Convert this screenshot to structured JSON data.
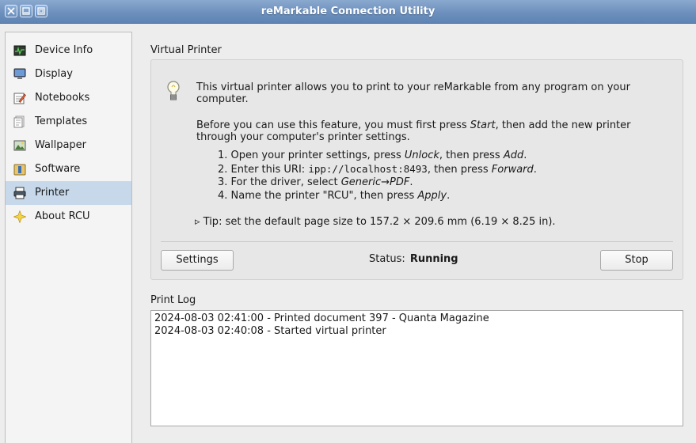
{
  "window": {
    "title": "reMarkable Connection Utility",
    "controls": [
      "close-icon",
      "minimize-icon",
      "maximize-icon"
    ]
  },
  "sidebar": {
    "items": [
      {
        "label": "Device Info",
        "icon": "device-info-icon"
      },
      {
        "label": "Display",
        "icon": "display-icon"
      },
      {
        "label": "Notebooks",
        "icon": "notebooks-icon"
      },
      {
        "label": "Templates",
        "icon": "templates-icon"
      },
      {
        "label": "Wallpaper",
        "icon": "wallpaper-icon"
      },
      {
        "label": "Software",
        "icon": "software-icon"
      },
      {
        "label": "Printer",
        "icon": "printer-icon",
        "selected": true
      },
      {
        "label": "About RCU",
        "icon": "about-icon"
      }
    ],
    "selected_color": "#c6d8ea"
  },
  "virtual_printer": {
    "title": "Virtual Printer",
    "intro_line1": "This virtual printer allows you to print to your reMarkable from any program on your",
    "intro_line2": "computer.",
    "before_pre": "Before you can use this feature, you must first press ",
    "before_em": "Start",
    "before_post": ", then add the new printer",
    "before_line2": "through your computer's printer settings.",
    "step1_pre": "1. Open your printer settings, press ",
    "step1_em1": "Unlock",
    "step1_mid": ", then press ",
    "step1_em2": "Add",
    "step1_post": ".",
    "step2_pre": "2. Enter this URI: ",
    "step2_uri": "ipp://localhost:8493",
    "step2_mid": ", then press ",
    "step2_em": "Forward",
    "step2_post": ".",
    "step3_pre": "3. For the driver, select ",
    "step3_em": "Generic→PDF",
    "step3_post": ".",
    "step4_pre": "4. Name the printer \"RCU\", then press ",
    "step4_em": "Apply",
    "step4_post": ".",
    "tip": "▹ Tip: set the default page size to 157.2 × 209.6 mm (6.19 × 8.25 in).",
    "settings_label": "Settings",
    "status_label": "Status:",
    "status_value": "Running",
    "stop_label": "Stop"
  },
  "print_log": {
    "title": "Print Log",
    "entries": [
      "2024-08-03 02:41:00 - Printed document 397 - Quanta Magazine",
      "2024-08-03 02:40:08 - Started virtual printer"
    ]
  }
}
